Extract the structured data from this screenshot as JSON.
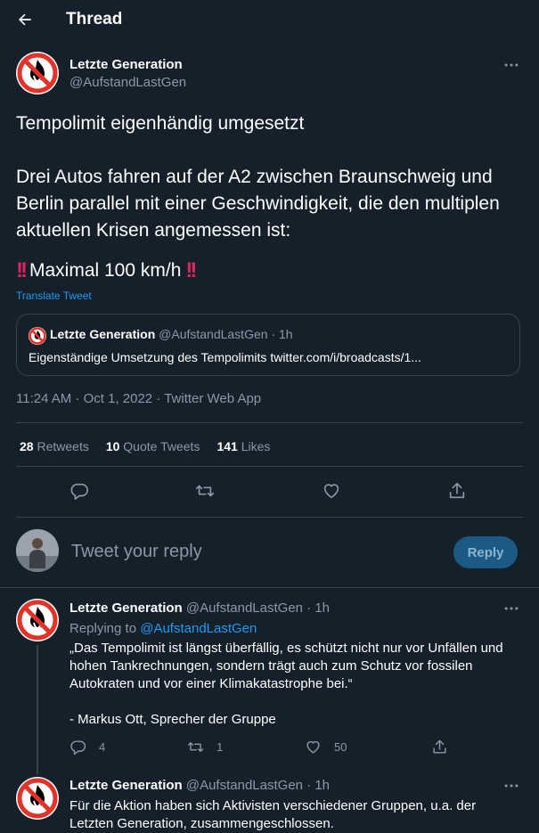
{
  "header": {
    "title": "Thread"
  },
  "tweet": {
    "author": "Letzte Generation",
    "handle": "@AufstandLastGen",
    "text": "Tempolimit eigenhändig umgesetzt\n\nDrei Autos fahren auf der A2 zwischen Braunschweig und Berlin parallel mit einer Geschwindigkeit, die den multiplen aktuellen Krisen angemessen ist:",
    "limit_text": "Maximal 100 km/h",
    "translate": "Translate Tweet",
    "quote": {
      "author": "Letzte Generation",
      "handle_time": "@AufstandLastGen · 1h",
      "text": "Eigenständige Umsetzung des Tempolimits twitter.com/i/broadcasts/1..."
    },
    "meta": "11:24 AM · Oct 1, 2022 · Twitter Web App",
    "stats": {
      "retweets": "28",
      "retweets_label": "Retweets",
      "quotes": "10",
      "quotes_label": "Quote Tweets",
      "likes": "141",
      "likes_label": "Likes"
    }
  },
  "compose": {
    "placeholder": "Tweet your reply",
    "button": "Reply"
  },
  "replies": [
    {
      "author": "Letzte Generation",
      "handle_time": "@AufstandLastGen · 1h",
      "replying_prefix": "Replying to",
      "replying_handle": "@AufstandLastGen",
      "text": "„Das Tempolimit ist längst überfällig, es schützt nicht nur vor Unfällen und hohen Tankrechnungen, sondern trägt auch zum Schutz vor fossilen Autokraten und vor einer Klimakatastrophe bei.“",
      "signature": "- Markus Ott, Sprecher der Gruppe",
      "replies_count": "4",
      "retweets_count": "1",
      "likes_count": "50"
    },
    {
      "author": "Letzte Generation",
      "handle_time": "@AufstandLastGen · 1h",
      "text": "Für die Aktion haben sich Aktivisten verschiedener Gruppen, u.a. der Letzten Generation, zusammengeschlossen."
    }
  ],
  "colors": {
    "background": "#15202b",
    "accent": "#1d9bf0",
    "alert": "#e0245e",
    "logo_red": "#e1332a"
  },
  "icons": [
    "back-arrow-icon",
    "more-icon",
    "reply-icon",
    "retweet-icon",
    "like-icon",
    "share-icon"
  ]
}
